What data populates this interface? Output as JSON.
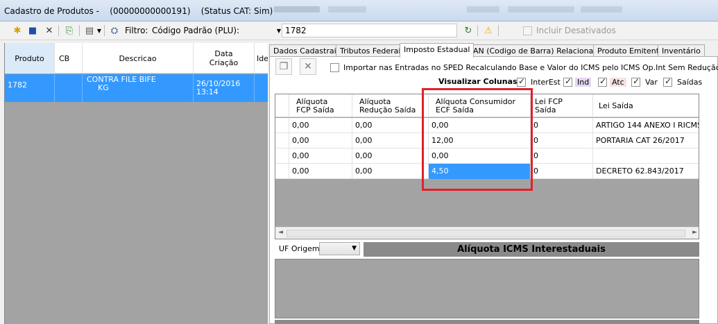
{
  "window": {
    "title": "Cadastro de Produtos -    (00000000000191)    (Status CAT: Sim)"
  },
  "toolbar": {
    "filter_label": "Filtro:",
    "filter_value": "Código Padrão (PLU):",
    "search_value": "1782",
    "include_inactive_label": "Incluir Desativados"
  },
  "products_grid": {
    "columns": [
      "Produto",
      "CB",
      "Descricao",
      "Data\nCriação",
      "Ide"
    ],
    "rows": [
      {
        "produto": "1782",
        "cb": "",
        "descricao_1": "CONTRA FILE BIFE",
        "descricao_2": "KG",
        "data_1": "26/10/2016",
        "data_2": "13:14"
      }
    ]
  },
  "tabs": [
    {
      "label": "Dados Cadastrais",
      "active": false
    },
    {
      "label": "Tributos Federais",
      "active": false
    },
    {
      "label": "Imposto Estadual",
      "active": true
    },
    {
      "label": "EAN (Codigo de Barra) Relacionados",
      "active": false
    },
    {
      "label": "Produto Emitente",
      "active": false
    },
    {
      "label": "Inventário",
      "active": false
    }
  ],
  "estadual": {
    "import_option_label": "Importar nas Entradas no SPED Recalculando Base e Valor do ICMS pelo ICMS Op.Int Sem Redução",
    "visualizar_label": "Visualizar Colunas:",
    "visualizar_options": [
      {
        "label": "InterEst",
        "checked": true,
        "color": "#ffffff"
      },
      {
        "label": "Ind",
        "checked": true,
        "color": "#e3d6f3"
      },
      {
        "label": "Atc",
        "checked": true,
        "color": "#f6e2e2"
      },
      {
        "label": "Var",
        "checked": true,
        "color": "#ffffff"
      },
      {
        "label": "Saídas",
        "checked": true,
        "color": "#ffffff"
      }
    ],
    "grid": {
      "columns": {
        "fcp_1": "Alíquota",
        "fcp_2": "FCP Saída",
        "red_1": "Alíquota",
        "red_2": "Redução Saída",
        "ecf_1": "Alíquota Consumidor",
        "ecf_2": "ECF Saída",
        "lei_fcp_1": "Lei FCP",
        "lei_fcp_2": "Saída",
        "lei": "Lei Saída"
      },
      "rows": [
        {
          "fcp": "0,00",
          "red": "0,00",
          "ecf": "0,00",
          "lei_fcp": "0",
          "lei": "ARTIGO 144 ANEXO I RICMS"
        },
        {
          "fcp": "0,00",
          "red": "0,00",
          "ecf": "12,00",
          "lei_fcp": "0",
          "lei": "PORTARIA CAT 26/2017"
        },
        {
          "fcp": "0,00",
          "red": "0,00",
          "ecf": "0,00",
          "lei_fcp": "0",
          "lei": ""
        },
        {
          "fcp": "0,00",
          "red": "0,00",
          "ecf": "4,50",
          "lei_fcp": "0",
          "lei": "DECRETO 62.843/2017"
        }
      ]
    },
    "uf_origem_label": "UF Origem:",
    "uf_origem_value": "",
    "banner": "Alíquota ICMS Interestaduais"
  },
  "colors": {
    "selection": "#3399ff",
    "highlight": "#e0202a",
    "grid_bg": "#a3a3a3"
  }
}
